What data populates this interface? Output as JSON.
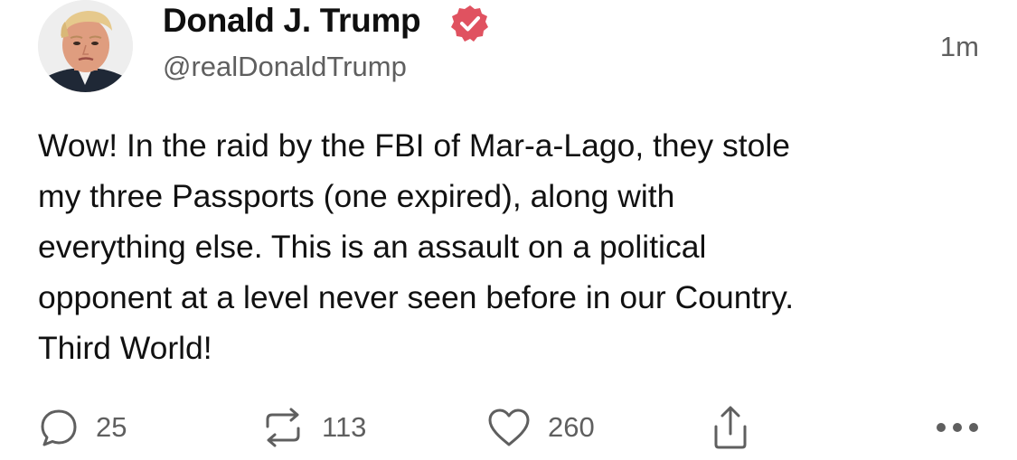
{
  "author": {
    "display_name": "Donald J. Trump",
    "handle": "@realDonaldTrump",
    "verified_icon": "verified-badge-icon",
    "verified_color": "#e05260"
  },
  "timestamp": "1m",
  "post": {
    "lines": [
      "Wow! In the raid by the FBI of Mar-a-Lago, they stole",
      "my three Passports (one expired), along with",
      "everything else. This is an assault on a political",
      "opponent at a level never seen before in our Country.",
      "Third World!"
    ]
  },
  "actions": {
    "replies": {
      "icon": "reply-icon",
      "count": "25"
    },
    "reposts": {
      "icon": "repost-icon",
      "count": "113"
    },
    "likes": {
      "icon": "heart-icon",
      "count": "260"
    },
    "share": {
      "icon": "share-icon"
    },
    "more": {
      "icon": "more-options-icon"
    }
  },
  "colors": {
    "text": "#111111",
    "secondary": "#5f5f5f",
    "verified": "#e05260"
  }
}
